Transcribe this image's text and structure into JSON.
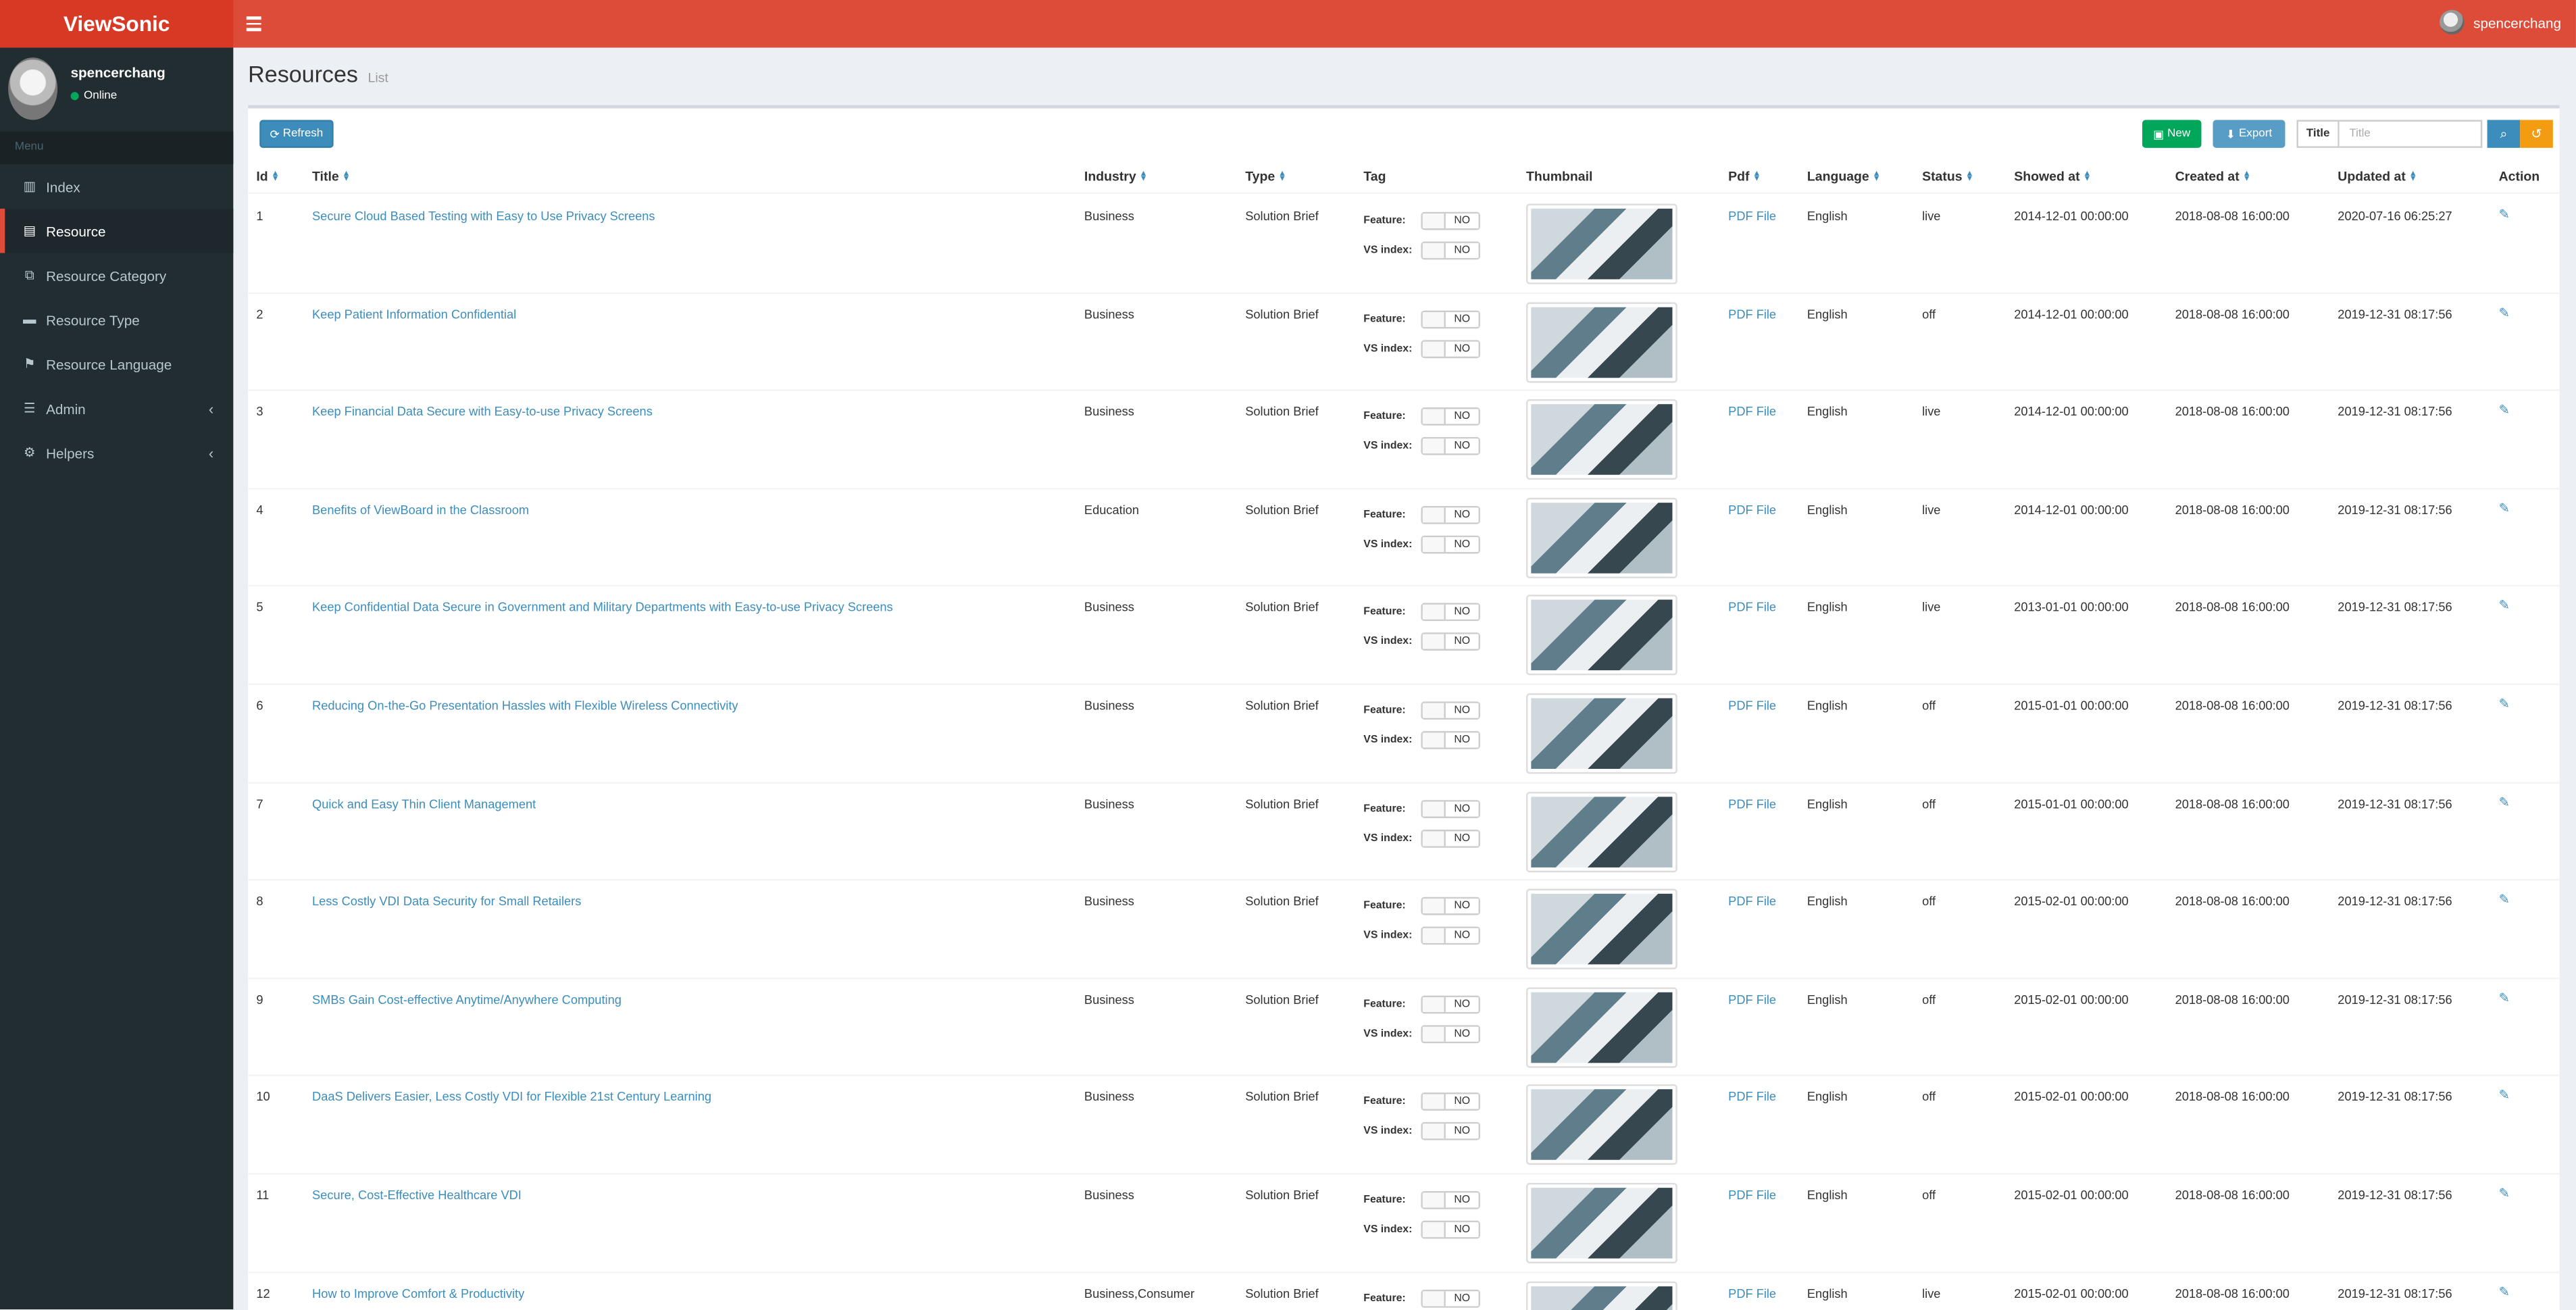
{
  "app": {
    "logo": "ViewSonic",
    "user": "spencerchang"
  },
  "sidebar": {
    "user": {
      "name": "spencerchang",
      "status": "Online"
    },
    "menu_header": "Menu",
    "items": [
      {
        "label": "Index",
        "icon": "bar-chart-icon"
      },
      {
        "label": "Resource",
        "icon": "file-icon",
        "active": true
      },
      {
        "label": "Resource Category",
        "icon": "sitemap-icon"
      },
      {
        "label": "Resource Type",
        "icon": "book-icon"
      },
      {
        "label": "Resource Language",
        "icon": "language-icon"
      },
      {
        "label": "Admin",
        "icon": "tasks-icon",
        "has_children": true
      },
      {
        "label": "Helpers",
        "icon": "cogs-icon",
        "has_children": true
      }
    ]
  },
  "page": {
    "title": "Resources",
    "subtitle": "List"
  },
  "toolbar": {
    "refresh_label": "Refresh",
    "new_label": "New",
    "export_label": "Export",
    "search_label": "Title",
    "search_placeholder": "Title"
  },
  "table": {
    "columns": [
      "Id",
      "Title",
      "Industry",
      "Type",
      "Tag",
      "Thumbnail",
      "Pdf",
      "Language",
      "Status",
      "Showed at",
      "Created at",
      "Updated at",
      "Action"
    ],
    "tag_labels": {
      "feature": "Feature:",
      "vs_index": "VS index:"
    },
    "toggle_value": "NO",
    "rows": [
      {
        "id": "1",
        "title": "Secure Cloud Based Testing with Easy to Use Privacy Screens",
        "industry": "Business",
        "type": "Solution Brief",
        "pdf": "PDF File",
        "language": "English",
        "status": "live",
        "showed_at": "2014-12-01 00:00:00",
        "created_at": "2018-08-08 16:00:00",
        "updated_at": "2020-07-16 06:25:27"
      },
      {
        "id": "2",
        "title": "Keep Patient Information Confidential",
        "industry": "Business",
        "type": "Solution Brief",
        "pdf": "PDF File",
        "language": "English",
        "status": "off",
        "showed_at": "2014-12-01 00:00:00",
        "created_at": "2018-08-08 16:00:00",
        "updated_at": "2019-12-31 08:17:56"
      },
      {
        "id": "3",
        "title": "Keep Financial Data Secure with Easy-to-use Privacy Screens",
        "industry": "Business",
        "type": "Solution Brief",
        "pdf": "PDF File",
        "language": "English",
        "status": "live",
        "showed_at": "2014-12-01 00:00:00",
        "created_at": "2018-08-08 16:00:00",
        "updated_at": "2019-12-31 08:17:56"
      },
      {
        "id": "4",
        "title": "Benefits of ViewBoard in the Classroom",
        "industry": "Education",
        "type": "Solution Brief",
        "pdf": "PDF File",
        "language": "English",
        "status": "live",
        "showed_at": "2014-12-01 00:00:00",
        "created_at": "2018-08-08 16:00:00",
        "updated_at": "2019-12-31 08:17:56"
      },
      {
        "id": "5",
        "title": "Keep Confidential Data Secure in Government and Military Departments with Easy-to-use Privacy Screens",
        "industry": "Business",
        "type": "Solution Brief",
        "pdf": "PDF File",
        "language": "English",
        "status": "live",
        "showed_at": "2013-01-01 00:00:00",
        "created_at": "2018-08-08 16:00:00",
        "updated_at": "2019-12-31 08:17:56"
      },
      {
        "id": "6",
        "title": "Reducing On-the-Go Presentation Hassles with Flexible Wireless Connectivity",
        "industry": "Business",
        "type": "Solution Brief",
        "pdf": "PDF File",
        "language": "English",
        "status": "off",
        "showed_at": "2015-01-01 00:00:00",
        "created_at": "2018-08-08 16:00:00",
        "updated_at": "2019-12-31 08:17:56"
      },
      {
        "id": "7",
        "title": "Quick and Easy Thin Client Management",
        "industry": "Business",
        "type": "Solution Brief",
        "pdf": "PDF File",
        "language": "English",
        "status": "off",
        "showed_at": "2015-01-01 00:00:00",
        "created_at": "2018-08-08 16:00:00",
        "updated_at": "2019-12-31 08:17:56"
      },
      {
        "id": "8",
        "title": "Less Costly VDI Data Security for Small Retailers",
        "industry": "Business",
        "type": "Solution Brief",
        "pdf": "PDF File",
        "language": "English",
        "status": "off",
        "showed_at": "2015-02-01 00:00:00",
        "created_at": "2018-08-08 16:00:00",
        "updated_at": "2019-12-31 08:17:56"
      },
      {
        "id": "9",
        "title": "SMBs Gain Cost-effective Anytime/Anywhere Computing",
        "industry": "Business",
        "type": "Solution Brief",
        "pdf": "PDF File",
        "language": "English",
        "status": "off",
        "showed_at": "2015-02-01 00:00:00",
        "created_at": "2018-08-08 16:00:00",
        "updated_at": "2019-12-31 08:17:56"
      },
      {
        "id": "10",
        "title": "DaaS Delivers Easier, Less Costly VDI for Flexible 21st Century Learning",
        "industry": "Business",
        "type": "Solution Brief",
        "pdf": "PDF File",
        "language": "English",
        "status": "off",
        "showed_at": "2015-02-01 00:00:00",
        "created_at": "2018-08-08 16:00:00",
        "updated_at": "2019-12-31 08:17:56"
      },
      {
        "id": "11",
        "title": "Secure, Cost-Effective Healthcare VDI",
        "industry": "Business",
        "type": "Solution Brief",
        "pdf": "PDF File",
        "language": "English",
        "status": "off",
        "showed_at": "2015-02-01 00:00:00",
        "created_at": "2018-08-08 16:00:00",
        "updated_at": "2019-12-31 08:17:56"
      },
      {
        "id": "12",
        "title": "How to Improve Comfort & Productivity",
        "industry": "Business,Consumer",
        "type": "Solution Brief",
        "pdf": "PDF File",
        "language": "English",
        "status": "live",
        "showed_at": "2015-02-01 00:00:00",
        "created_at": "2018-08-08 16:00:00",
        "updated_at": "2019-12-31 08:17:56"
      }
    ]
  },
  "colors": {
    "header": "#dd4b39",
    "sidebar": "#222d32",
    "link": "#3c8dbc",
    "new": "#00a65a",
    "reset": "#f39c12"
  }
}
